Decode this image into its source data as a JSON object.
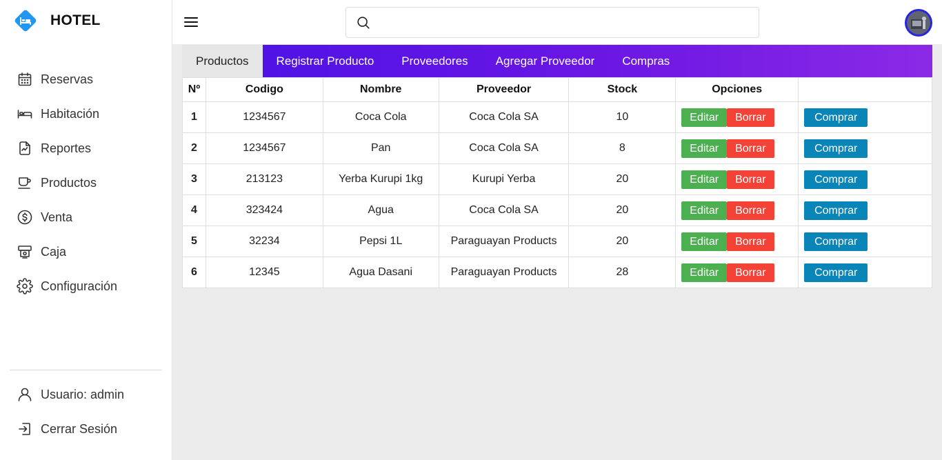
{
  "brand": {
    "title": "HOTEL",
    "accent": "#2196f3"
  },
  "sidebar": {
    "items": [
      {
        "label": "Reservas",
        "icon": "calendar-icon"
      },
      {
        "label": "Habitación",
        "icon": "bed-icon"
      },
      {
        "label": "Reportes",
        "icon": "report-icon"
      },
      {
        "label": "Productos",
        "icon": "cup-icon"
      },
      {
        "label": "Venta",
        "icon": "dollar-icon"
      },
      {
        "label": "Caja",
        "icon": "register-icon"
      },
      {
        "label": "Configuración",
        "icon": "gear-icon"
      }
    ],
    "bottom": [
      {
        "label": "Usuario: admin",
        "icon": "user-icon"
      },
      {
        "label": "Cerrar Sesión",
        "icon": "logout-icon"
      }
    ]
  },
  "header": {
    "search_placeholder": ""
  },
  "tabs": [
    {
      "label": "Productos",
      "active": true
    },
    {
      "label": "Registrar Producto",
      "active": false
    },
    {
      "label": "Proveedores",
      "active": false
    },
    {
      "label": "Agregar Proveedor",
      "active": false
    },
    {
      "label": "Compras",
      "active": false
    }
  ],
  "table": {
    "headers": [
      "Nº",
      "Codigo",
      "Nombre",
      "Proveedor",
      "Stock",
      "Opciones",
      ""
    ],
    "rows": [
      {
        "n": "1",
        "codigo": "1234567",
        "nombre": "Coca Cola",
        "proveedor": "Coca Cola SA",
        "stock": "10"
      },
      {
        "n": "2",
        "codigo": "1234567",
        "nombre": "Pan",
        "proveedor": "Coca Cola SA",
        "stock": "8"
      },
      {
        "n": "3",
        "codigo": "213123",
        "nombre": "Yerba Kurupi 1kg",
        "proveedor": "Kurupi Yerba",
        "stock": "20"
      },
      {
        "n": "4",
        "codigo": "323424",
        "nombre": "Agua",
        "proveedor": "Coca Cola SA",
        "stock": "20"
      },
      {
        "n": "5",
        "codigo": "32234",
        "nombre": "Pepsi 1L",
        "proveedor": "Paraguayan Products",
        "stock": "20"
      },
      {
        "n": "6",
        "codigo": "12345",
        "nombre": "Agua Dasani",
        "proveedor": "Paraguayan Products",
        "stock": "28"
      }
    ],
    "actions": {
      "edit": "Editar",
      "delete": "Borrar",
      "buy": "Comprar"
    }
  },
  "colors": {
    "edit": "#4caf50",
    "delete": "#f44336",
    "buy": "#0a85b8",
    "tabs_start": "#4a12e6",
    "tabs_end": "#8b2ae6"
  }
}
